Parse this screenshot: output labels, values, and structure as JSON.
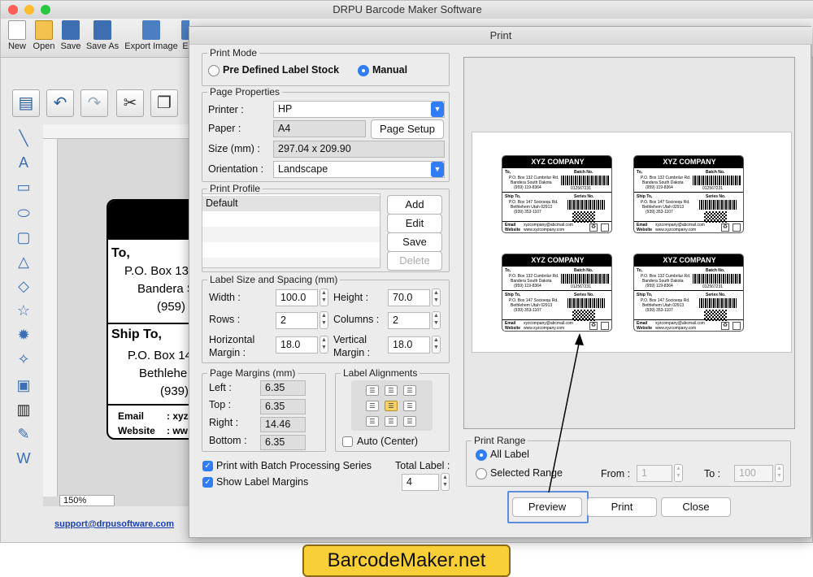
{
  "main_window": {
    "title": "DRPU Barcode Maker Software"
  },
  "toolbar": {
    "items": [
      {
        "label": "New",
        "icon": "new-file-icon"
      },
      {
        "label": "Open",
        "icon": "open-folder-icon"
      },
      {
        "label": "Save",
        "icon": "save-icon"
      },
      {
        "label": "Save As",
        "icon": "save-as-icon"
      },
      {
        "label": "Export Image",
        "icon": "export-image-icon"
      },
      {
        "label": "E",
        "icon": "export-icon"
      }
    ]
  },
  "canvas": {
    "zoom": "150%",
    "label_preview": {
      "to": "To,",
      "address1": "P.O. Box 13",
      "address2": "Bandera S",
      "phone1": "(959)",
      "ship_to": "Ship To,",
      "ship_address1": "P.O. Box 14",
      "ship_address2": "Bethlehe",
      "phone2": "(939)",
      "email_label": "Email",
      "email_value": ": xyz",
      "website_label": "Website",
      "website_value": ": ww"
    }
  },
  "support_link": "support@drpusoftware.com",
  "dialog": {
    "title": "Print",
    "print_mode": {
      "legend": "Print Mode",
      "options": [
        "Pre Defined Label Stock",
        "Manual"
      ],
      "selected": "Manual"
    },
    "page_properties": {
      "legend": "Page Properties",
      "printer_label": "Printer :",
      "printer_value": "HP",
      "paper_label": "Paper :",
      "paper_value": "A4",
      "page_setup_button": "Page Setup",
      "size_label": "Size (mm) :",
      "size_value": "297.04 x 209.90",
      "orientation_label": "Orientation :",
      "orientation_value": "Landscape"
    },
    "print_profile": {
      "legend": "Print Profile",
      "items": [
        "Default"
      ],
      "buttons": {
        "add": "Add",
        "edit": "Edit",
        "save": "Save",
        "delete": "Delete"
      }
    },
    "label_size": {
      "legend": "Label Size and Spacing (mm)",
      "width_label": "Width :",
      "width_value": "100.0",
      "height_label": "Height :",
      "height_value": "70.0",
      "rows_label": "Rows :",
      "rows_value": "2",
      "columns_label": "Columns :",
      "columns_value": "2",
      "hmargin_label_1": "Horizontal",
      "hmargin_label_2": "Margin :",
      "hmargin_value": "18.0",
      "vmargin_label_1": "Vertical",
      "vmargin_label_2": "Margin :",
      "vmargin_value": "18.0"
    },
    "page_margins": {
      "legend": "Page Margins (mm)",
      "left_label": "Left :",
      "left_value": "6.35",
      "top_label": "Top :",
      "top_value": "6.35",
      "right_label": "Right :",
      "right_value": "14.46",
      "bottom_label": "Bottom :",
      "bottom_value": "6.35"
    },
    "label_alignments": {
      "legend": "Label Alignments",
      "selected": "middle-center",
      "auto_center_label": "Auto (Center)",
      "auto_center_checked": false
    },
    "batch_processing": {
      "label": "Print with Batch Processing Series",
      "checked": true
    },
    "show_margins": {
      "label": "Show Label Margins",
      "checked": true
    },
    "total_label": {
      "label": "Total Label :",
      "value": "4"
    },
    "preview_cards": {
      "company": "XYZ COMPANY",
      "to": "To,",
      "addr1": "P.O. Box 132 Cumbrilur Rd.",
      "addr2": "Bandera South Dakota",
      "phone1": "(959) 119-8364",
      "batch": "Batch No.",
      "batch_num": "012567231",
      "ship_to": "Ship To,",
      "saddr1": "P.O. Box 147 Socioequ Rd.",
      "saddr2": "Bethlehem Utah 02913",
      "phone2": "(939) 353-1107",
      "series": "Series No.",
      "email": "Email",
      "email_val": "xyzcompany@abcmail.com",
      "website": "Website",
      "website_val": "www.xyzcompany.com"
    },
    "print_range": {
      "legend": "Print Range",
      "all_label": "All Label",
      "selected_range": "Selected Range",
      "selected": "All Label",
      "from_label": "From :",
      "from_value": "1",
      "to_label": "To :",
      "to_value": "100"
    },
    "buttons": {
      "preview": "Preview",
      "print": "Print",
      "close": "Close"
    }
  },
  "banner": "BarcodeMaker.net",
  "colors": {
    "accent": "#2f7cf6",
    "banner_bg": "#f8cf36"
  }
}
